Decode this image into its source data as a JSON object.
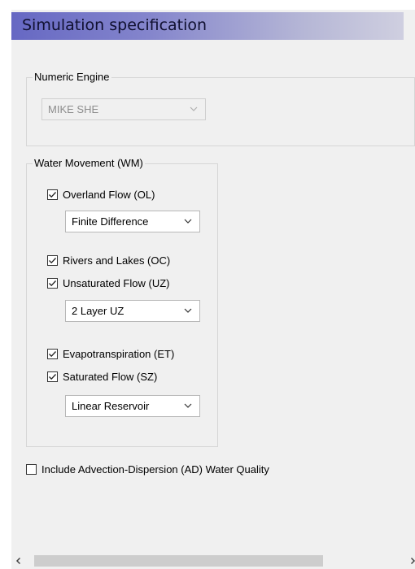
{
  "header": {
    "title": "Simulation specification"
  },
  "numeric_engine": {
    "legend": "Numeric Engine",
    "selected": "MIKE SHE",
    "disabled": true
  },
  "water_movement": {
    "legend": "Water Movement (WM)",
    "overland_flow": {
      "label": "Overland Flow (OL)",
      "checked": true,
      "method": "Finite Difference"
    },
    "rivers_lakes": {
      "label": "Rivers and Lakes (OC)",
      "checked": true
    },
    "unsaturated_flow": {
      "label": "Unsaturated Flow (UZ)",
      "checked": true,
      "method": "2 Layer UZ"
    },
    "evapotranspiration": {
      "label": "Evapotranspiration (ET)",
      "checked": true
    },
    "saturated_flow": {
      "label": "Saturated Flow (SZ)",
      "checked": true,
      "method": "Linear Reservoir"
    }
  },
  "advection_dispersion": {
    "label": "Include Advection-Dispersion (AD) Water Quality",
    "checked": false
  },
  "icons": {
    "dropdown": "chevron-down-icon",
    "check": "checkmark-icon",
    "scroll_left": "scroll-left-arrow-icon",
    "scroll_right": "scroll-right-arrow-icon"
  }
}
